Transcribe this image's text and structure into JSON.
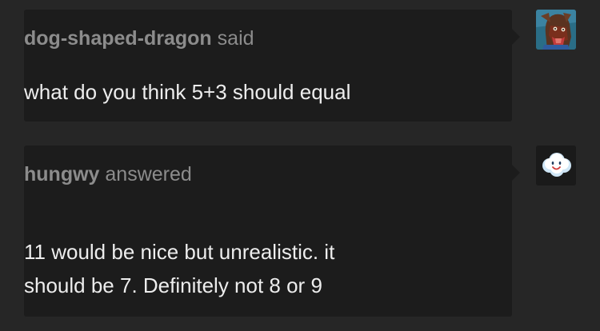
{
  "ask": {
    "username": "dog-shaped-dragon",
    "action": "said",
    "message": "what do you think 5+3 should equal"
  },
  "answer": {
    "username": "hungwy",
    "action": "answered",
    "lines": [
      "11 would be nice but unrealistic. it",
      "should be 7. Definitely not 8 or 9"
    ]
  },
  "avatars": {
    "asker_icon": "dog-dragon-avatar-icon",
    "answerer_icon": "smiling-cloud-avatar-icon"
  },
  "colors": {
    "page_background": "#262626",
    "bubble_background": "#1c1c1c",
    "header_text": "#8c8c8c",
    "body_text": "#ededed"
  }
}
